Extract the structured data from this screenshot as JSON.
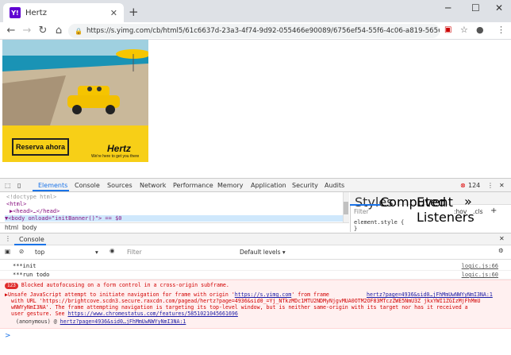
{
  "browser": {
    "tab_title": "Hertz",
    "favicon_text": "Y!",
    "url": "https://s.yimg.com/cb/html5/61c6637d-23a3-4f74-9d92-055466e90089/6756ef54-55f6-4c06-a819-5656d8552f56...",
    "icons": [
      "back-icon",
      "forward-icon",
      "reload-icon",
      "home-icon",
      "lock-icon",
      "star-icon",
      "profile-icon",
      "menu-icon"
    ]
  },
  "ad": {
    "cta_label": "Reserva ahora",
    "logo": "Hertz",
    "tagline": "We're here to get you there"
  },
  "devtools": {
    "tabs": [
      "Elements",
      "Console",
      "Sources",
      "Network",
      "Performance",
      "Memory",
      "Application",
      "Security",
      "Audits"
    ],
    "active_tab": "Elements",
    "error_count": "124",
    "elements_lines": [
      "<!doctype html>",
      "<html>",
      "▶<head>…</head>",
      "▼<body onload=\"initBanner()\"> == $0"
    ],
    "breadcrumbs": [
      "html",
      "body"
    ],
    "styles_tabs": [
      "Styles",
      "Computed",
      "Event Listeners",
      "»"
    ],
    "filter_placeholder": "Filter",
    "hov": ":hov",
    "cls": ".cls",
    "element_style": "element.style {",
    "brace": "}"
  },
  "console": {
    "drawer_tab": "Console",
    "context": "top",
    "filter_placeholder": "Filter",
    "levels": "Default levels ▾",
    "messages": [
      {
        "text": "***init",
        "source": "logic.js:66"
      },
      {
        "text": "***run todo",
        "source": "logic.js:60"
      }
    ],
    "error": {
      "count": "123",
      "line1": "Blocked autofocusing on a form control in a cross-origin subframe.",
      "line2a": "▶Unsafe JavaScript attempt to initiate navigation for frame with origin '",
      "line2link": "https://s.yimg.com",
      "line2b": "' from frame",
      "src_link": "hertz?page=4936&sid0…jFhMmUwNWYyNmI3NA:1",
      "line3": "with URL 'https://brightcove.scdn3.secure.raxcdn.com/pagead/hertz?page=4936&sid0_=Yj_NTkzMDc1MTU2NDMyNjgvMUA0OTM2OF83MTczZWE5NmU3Z jkxYWI1ZGIzMjFhMmU",
      "line4": "wNWYyNmI3NA'. The frame attempting navigation is targeting its top-level window, but is neither same-origin with its target nor has it received a",
      "line5": "user gesture. See",
      "line5link": "https://www.chromestatus.com/features/5851021045661696",
      "line6": "(anonymous) @",
      "line6link": "hertz?page=4936&sid0…jFhMmUwNWYyNmI3NA:1"
    },
    "prompt": ">"
  }
}
